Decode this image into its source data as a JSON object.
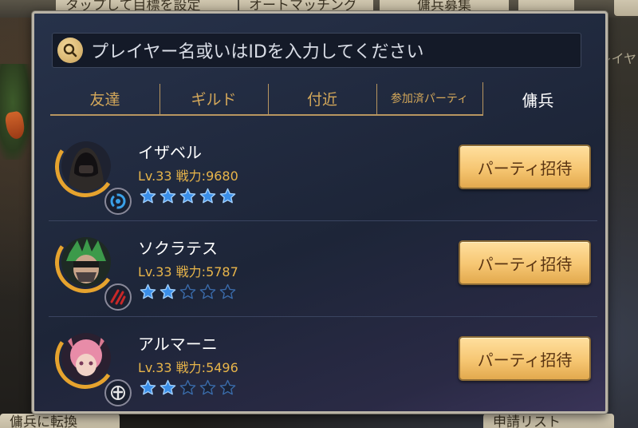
{
  "background": {
    "top_tabs": [
      "タップして目標を設定",
      "オートマッチング",
      "傭兵募集"
    ],
    "bottom_tabs": [
      "傭兵に転換",
      "申請リスト"
    ],
    "side_text": "プレイヤ"
  },
  "search": {
    "placeholder": "プレイヤー名或いはIDを入力してください"
  },
  "tabs": [
    {
      "label": "友達",
      "active": false
    },
    {
      "label": "ギルド",
      "active": false
    },
    {
      "label": "付近",
      "active": false
    },
    {
      "label": "参加済パーティ",
      "active": false
    },
    {
      "label": "傭兵",
      "active": true
    }
  ],
  "players": [
    {
      "name": "イザベル",
      "stats": "Lv.33 戦力:9680",
      "stars": 5,
      "class_icon": "cycle-class-icon",
      "button": "パーティ招待"
    },
    {
      "name": "ソクラテス",
      "stats": "Lv.33 戦力:5787",
      "stars": 2,
      "class_icon": "red-claw-class-icon",
      "button": "パーティ招待"
    },
    {
      "name": "アルマーニ",
      "stats": "Lv.33 戦力:5496",
      "stars": 2,
      "class_icon": "cross-class-icon",
      "button": "パーティ招待"
    }
  ],
  "colors": {
    "accent_gold": "#e8b54a",
    "star_blue": "#3a8ee8",
    "button_gold": "#f6c672"
  }
}
